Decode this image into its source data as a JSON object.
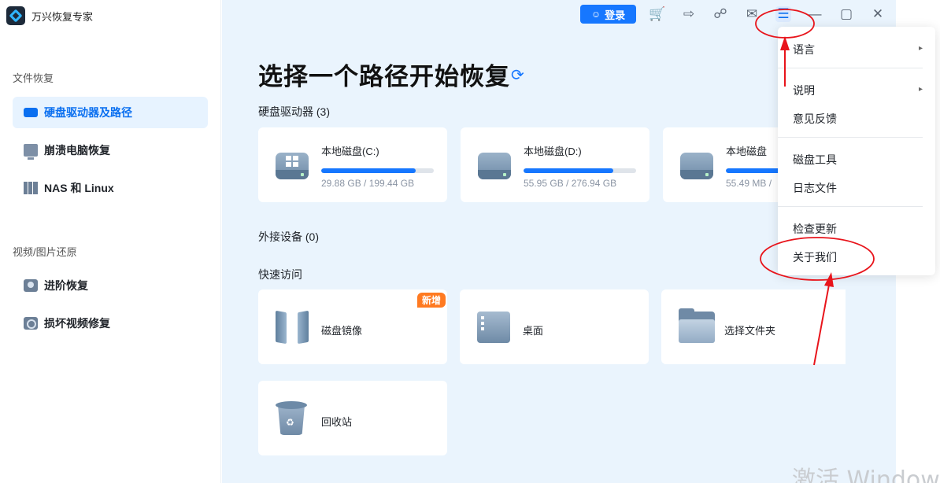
{
  "app": {
    "name": "万兴恢复专家"
  },
  "sidebar": {
    "section1": "文件恢复",
    "items1": [
      {
        "label": "硬盘驱动器及路径",
        "icon": "hard-drive-icon",
        "active": true
      },
      {
        "label": "崩溃电脑恢复",
        "icon": "computer-icon",
        "active": false
      },
      {
        "label": "NAS 和 Linux",
        "icon": "nas-icon",
        "active": false
      }
    ],
    "section2": "视频/图片还原",
    "items2": [
      {
        "label": "进阶恢复",
        "icon": "camera-icon"
      },
      {
        "label": "损坏视频修复",
        "icon": "video-repair-icon"
      }
    ]
  },
  "toolbar": {
    "login_label": "登录",
    "icons": [
      "cart-icon",
      "sign-in-icon",
      "headset-icon",
      "mail-icon",
      "menu-icon",
      "minimize-icon",
      "maximize-icon",
      "close-icon"
    ]
  },
  "main": {
    "title": "选择一个路径开始恢复",
    "drives_header": "硬盘驱动器  (3)",
    "drives": [
      {
        "name": "本地磁盘(C:)",
        "size": "29.88 GB / 199.44 GB",
        "used_fraction": 0.84
      },
      {
        "name": "本地磁盘(D:)",
        "size": "55.95 GB / 276.94 GB",
        "used_fraction": 0.8
      },
      {
        "name": "本地磁盘",
        "size": "55.49 MB /",
        "used_fraction": 0.5
      }
    ],
    "external_header": "外接设备  (0)",
    "quick_header": "快速访问",
    "quick": [
      {
        "label": "磁盘镜像",
        "badge": "新增"
      },
      {
        "label": "桌面"
      },
      {
        "label": "选择文件夹"
      },
      {
        "label": "回收站"
      }
    ]
  },
  "menu": {
    "items": [
      {
        "label": "语言",
        "submenu": true
      },
      {
        "label": "说明",
        "submenu": true
      },
      {
        "label": "意见反馈"
      },
      {
        "label": "磁盘工具"
      },
      {
        "label": "日志文件"
      },
      {
        "label": "检查更新"
      },
      {
        "label": "关于我们"
      }
    ]
  },
  "watermark": "激活 Window",
  "colors": {
    "accent": "#1677ff",
    "annotation": "#e8141b",
    "badge": "#ff7a21",
    "main_bg": "#eaf4fd"
  }
}
